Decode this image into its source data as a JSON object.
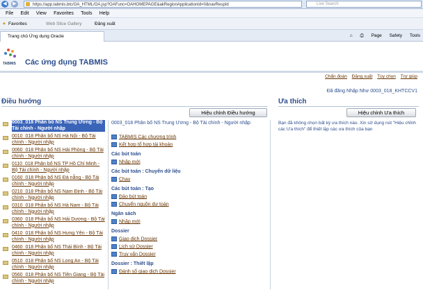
{
  "browser": {
    "url": "https://app.tabmis.btc/OA_HTML/OA.jsp?OAFunc=OAHOMEPAGE&akRegionApplicationId=0&navRespId",
    "search_placeholder": "Live Search",
    "menu": [
      "File",
      "Edit",
      "View",
      "Favorites",
      "Tools",
      "Help"
    ],
    "favorites_label": "Favorites",
    "web_slice_label": "Web Slice Gallery",
    "logout_fav": "Đăng xuất",
    "tab_title": "Trang chủ Ứng dụng Oracle",
    "tools": [
      "Page",
      "Safety",
      "Tools"
    ]
  },
  "app": {
    "logo_text": "TABMIS",
    "title": "Các ứng dụng TABMIS",
    "links": [
      "Chẩn đoán",
      "Đăng xuất",
      "Tùy chọn",
      "Trợ giúp"
    ],
    "login_status": "Đã đăng Nhập Như 0003_018_KHTCCV1"
  },
  "navigation": {
    "title": "Điều hướng",
    "edit_button": "Hiệu chỉnh Điều hướng",
    "tree": [
      "0003_018 Phân bổ NS Trung Ương - Bộ Tài chính - Người nhập",
      "0010_018 Phân bổ NS Hà Nội - Bộ Tài chính - Người nhập",
      "0060_018 Phân bổ NS Hải Phòng - Bộ Tài chính - Người nhập",
      "0110_018 Phân bổ NS TP Hồ Chí Minh - Bộ Tài chính - Người nhập",
      "0160_018 Phân bổ NS Đà nẵng - Bộ Tài chính - Người nhập",
      "0210_018 Phân bổ NS Nam Định - Bộ Tài chính - Người nhập",
      "0310_018 Phân bổ NS Hà Nam - Bộ Tài chính - Người nhập",
      "0360_018 Phân bổ NS Hải Dương - Bộ Tài chính - Người nhập",
      "0410_018 Phân bổ NS Hưng Yên - Bộ Tài chính - Người nhập",
      "0460_018 Phân bổ NS Thái Bình - Bộ Tài chính - Người nhập",
      "0510_018 Phân bổ NS Long An - Bộ Tài chính - Người nhập",
      "0560_018 Phân bổ NS Tiền Giang - Bộ Tài chính - Người nhập"
    ],
    "selected_title": "0003_018 Phân bổ NS Trung Ương - Bộ Tài chính - Người nhập",
    "groups": [
      {
        "heading": "",
        "links": [
          "TABMIS Các chương trình",
          "Kết hợp tổ hợp tài khoản"
        ]
      },
      {
        "heading": "Các bút toán",
        "links": [
          "Nhập mới"
        ]
      },
      {
        "heading": "Các bút toán : Chuyển dữ liệu",
        "links": [
          "Chạy"
        ]
      },
      {
        "heading": "Các bút toán : Tạo",
        "links": [
          "Đảo bút toán",
          "Chuyển nguồn dư toán"
        ]
      },
      {
        "heading": "Ngân sách",
        "links": [
          "Nhập mới"
        ]
      },
      {
        "heading": "Dossier",
        "links": [
          "Giao dịch Dossier",
          "Lịch sử Dossier",
          "Truy vấn Dossier"
        ]
      },
      {
        "heading": "Dossier : Thiết lập",
        "links": [
          "Đánh số giao dịch Dossier"
        ]
      }
    ]
  },
  "favorites": {
    "title": "Ưa thích",
    "edit_button": "Hiệu chỉnh Ưa thích",
    "message": "Bạn đã không chọn bất kỳ ưa thích nào. Xin sử dụng nút \"Hiệu chỉnh các Ưa thích\" để thiết lập các ưa thích của bạn"
  },
  "colors": {
    "accent": "#2c4d8e",
    "link": "#663300",
    "selected_bg": "#3a64b8"
  }
}
